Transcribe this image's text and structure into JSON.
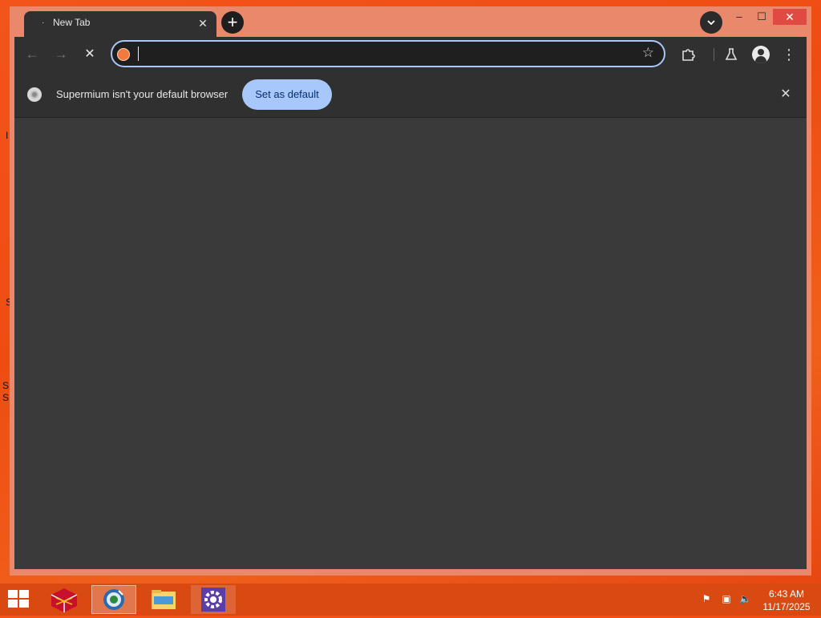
{
  "desktop": {
    "fragments": [
      "I",
      "S",
      "S",
      "S"
    ]
  },
  "browser": {
    "tab": {
      "title": "New Tab",
      "close_glyph": "✕"
    },
    "new_tab_glyph": "+",
    "tab_search_glyph": "⌄",
    "window_controls": {
      "minimize": "–",
      "maximize": "☐",
      "close": "✕"
    },
    "nav": {
      "back": "←",
      "forward": "→",
      "stop": "✕"
    },
    "omnibox": {
      "value": "",
      "placeholder": ""
    },
    "toolbar_icons": [
      "star-icon",
      "extensions-icon",
      "labs-icon",
      "profile-icon",
      "menu-icon"
    ],
    "star_glyph": "☆",
    "extensions_glyph": "⧉",
    "labs_glyph": "⚗",
    "menu_glyph": "⋮",
    "infobar": {
      "message": "Supermium isn't your default browser",
      "button_label": "Set as default",
      "close_glyph": "✕"
    },
    "colors": {
      "accent": "#a8c7fa",
      "tab_bg": "#303030",
      "content_bg": "#3a3a3a",
      "frame": "#e9886a"
    }
  },
  "taskbar": {
    "apps": [
      "winrar-app",
      "supermium-app",
      "file-explorer-app",
      "settings-app"
    ],
    "tray": {
      "flag_glyph": "⚑",
      "network_glyph": "▣",
      "volume_glyph": "🔈"
    },
    "time": "6:43 AM",
    "date": "11/17/2025"
  }
}
